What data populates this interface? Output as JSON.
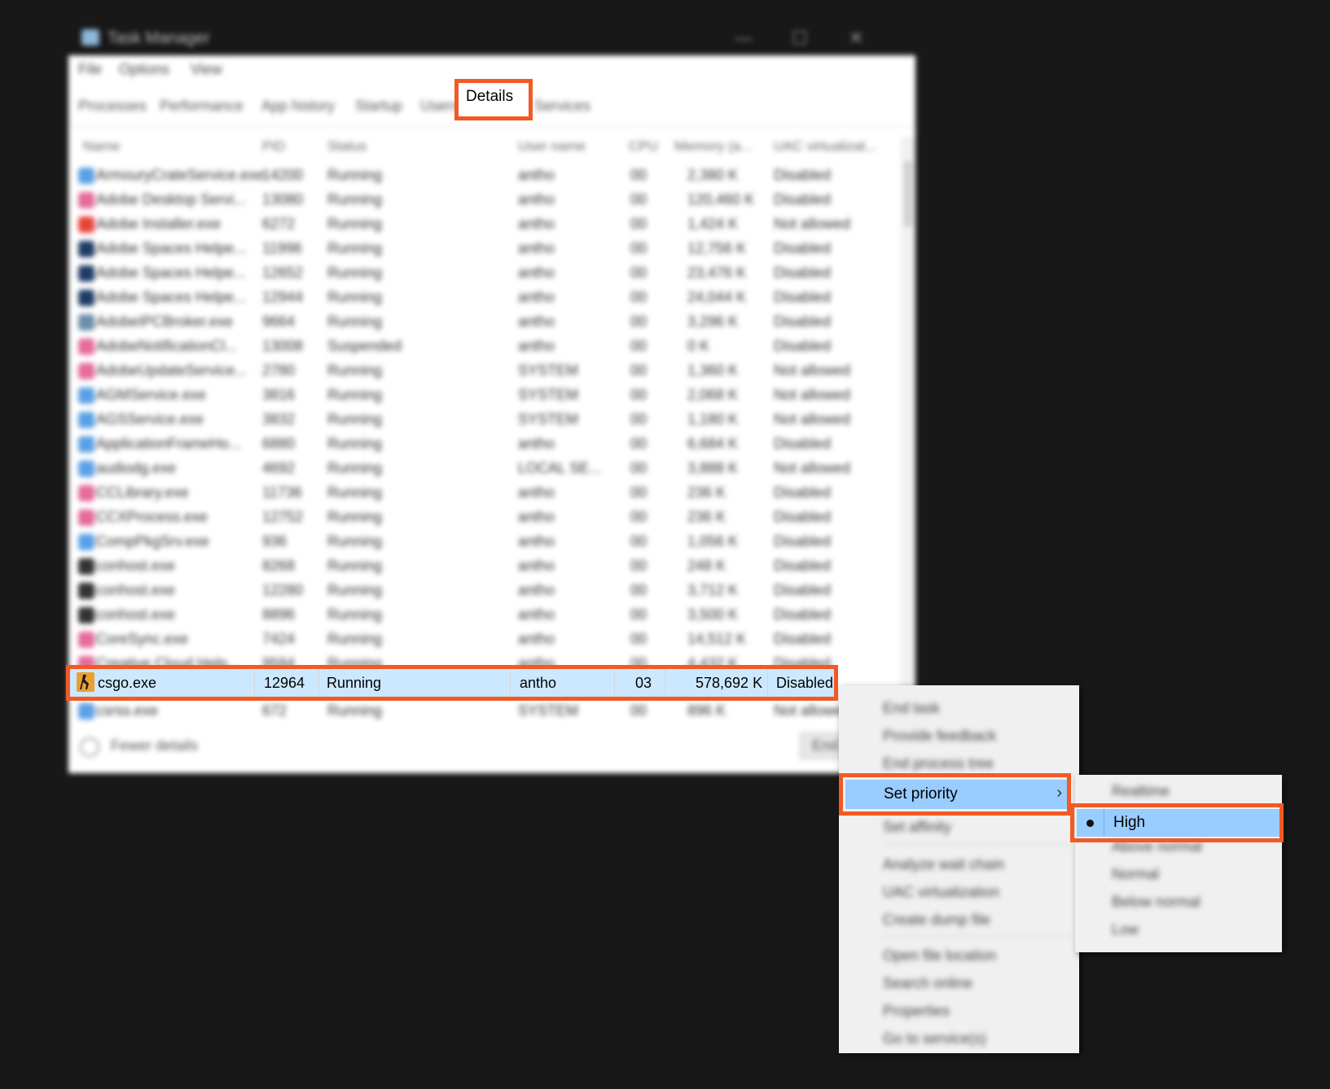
{
  "window": {
    "title": "Task Manager",
    "controls": [
      "—",
      "☐",
      "✕"
    ]
  },
  "menubar": [
    "File",
    "Options",
    "View"
  ],
  "tabs": {
    "processes": "Processes",
    "performance": "Performance",
    "app_history": "App history",
    "startup": "Startup",
    "users": "Users",
    "details": "Details",
    "services": "Services"
  },
  "columns": [
    "Name",
    "PID",
    "Status",
    "User name",
    "CPU",
    "Memory (a...",
    "UAC virtualizat..."
  ],
  "rows": [
    {
      "name": "ArmouryCrateService.exe",
      "pid": "14200",
      "status": "Running",
      "user": "antho",
      "cpu": "00",
      "mem": "2,380 K",
      "uac": "Disabled",
      "icon_color": "#5aa0e6"
    },
    {
      "name": "Adobe Desktop Servi...",
      "pid": "13080",
      "status": "Running",
      "user": "antho",
      "cpu": "00",
      "mem": "120,460 K",
      "uac": "Disabled",
      "icon_color": "#e56b9a"
    },
    {
      "name": "Adobe Installer.exe",
      "pid": "6272",
      "status": "Running",
      "user": "antho",
      "cpu": "00",
      "mem": "1,424 K",
      "uac": "Not allowed",
      "icon_color": "#e8443a"
    },
    {
      "name": "Adobe Spaces Helpe...",
      "pid": "11996",
      "status": "Running",
      "user": "antho",
      "cpu": "00",
      "mem": "12,756 K",
      "uac": "Disabled",
      "icon_color": "#1f3c66"
    },
    {
      "name": "Adobe Spaces Helpe...",
      "pid": "12652",
      "status": "Running",
      "user": "antho",
      "cpu": "00",
      "mem": "23,476 K",
      "uac": "Disabled",
      "icon_color": "#1f3c66"
    },
    {
      "name": "Adobe Spaces Helpe...",
      "pid": "12944",
      "status": "Running",
      "user": "antho",
      "cpu": "00",
      "mem": "24,044 K",
      "uac": "Disabled",
      "icon_color": "#1f3c66"
    },
    {
      "name": "AdobeIPCBroker.exe",
      "pid": "9664",
      "status": "Running",
      "user": "antho",
      "cpu": "00",
      "mem": "3,296 K",
      "uac": "Disabled",
      "icon_color": "#6a8fa8"
    },
    {
      "name": "AdobeNotificationCl...",
      "pid": "13008",
      "status": "Suspended",
      "user": "antho",
      "cpu": "00",
      "mem": "0 K",
      "uac": "Disabled",
      "icon_color": "#e56b9a"
    },
    {
      "name": "AdobeUpdateService...",
      "pid": "2780",
      "status": "Running",
      "user": "SYSTEM",
      "cpu": "00",
      "mem": "1,360 K",
      "uac": "Not allowed",
      "icon_color": "#e56b9a"
    },
    {
      "name": "AGMService.exe",
      "pid": "3816",
      "status": "Running",
      "user": "SYSTEM",
      "cpu": "00",
      "mem": "2,068 K",
      "uac": "Not allowed",
      "icon_color": "#5aa0e6"
    },
    {
      "name": "AGSService.exe",
      "pid": "3832",
      "status": "Running",
      "user": "SYSTEM",
      "cpu": "00",
      "mem": "1,180 K",
      "uac": "Not allowed",
      "icon_color": "#5aa0e6"
    },
    {
      "name": "ApplicationFrameHo...",
      "pid": "6880",
      "status": "Running",
      "user": "antho",
      "cpu": "00",
      "mem": "6,684 K",
      "uac": "Disabled",
      "icon_color": "#5aa0e6"
    },
    {
      "name": "audiodg.exe",
      "pid": "4692",
      "status": "Running",
      "user": "LOCAL SE...",
      "cpu": "00",
      "mem": "3,888 K",
      "uac": "Not allowed",
      "icon_color": "#5aa0e6"
    },
    {
      "name": "CCLibrary.exe",
      "pid": "11736",
      "status": "Running",
      "user": "antho",
      "cpu": "00",
      "mem": "236 K",
      "uac": "Disabled",
      "icon_color": "#e56b9a"
    },
    {
      "name": "CCXProcess.exe",
      "pid": "12752",
      "status": "Running",
      "user": "antho",
      "cpu": "00",
      "mem": "236 K",
      "uac": "Disabled",
      "icon_color": "#e56b9a"
    },
    {
      "name": "CompPkgSrv.exe",
      "pid": "936",
      "status": "Running",
      "user": "antho",
      "cpu": "00",
      "mem": "1,056 K",
      "uac": "Disabled",
      "icon_color": "#5aa0e6"
    },
    {
      "name": "conhost.exe",
      "pid": "8268",
      "status": "Running",
      "user": "antho",
      "cpu": "00",
      "mem": "248 K",
      "uac": "Disabled",
      "icon_color": "#333333"
    },
    {
      "name": "conhost.exe",
      "pid": "12280",
      "status": "Running",
      "user": "antho",
      "cpu": "00",
      "mem": "3,712 K",
      "uac": "Disabled",
      "icon_color": "#333333"
    },
    {
      "name": "conhost.exe",
      "pid": "8896",
      "status": "Running",
      "user": "antho",
      "cpu": "00",
      "mem": "3,500 K",
      "uac": "Disabled",
      "icon_color": "#333333"
    },
    {
      "name": "CoreSync.exe",
      "pid": "7424",
      "status": "Running",
      "user": "antho",
      "cpu": "00",
      "mem": "14,512 K",
      "uac": "Disabled",
      "icon_color": "#e56b9a"
    },
    {
      "name": "Creative Cloud Help...",
      "pid": "9584",
      "status": "Running",
      "user": "antho",
      "cpu": "00",
      "mem": "4,432 K",
      "uac": "Disabled",
      "icon_color": "#e56b9a"
    }
  ],
  "after_row": {
    "name": "csrss.exe",
    "pid": "672",
    "status": "Running",
    "user": "SYSTEM",
    "cpu": "00",
    "mem": "896 K",
    "uac": "Not allowed",
    "icon_color": "#5aa0e6"
  },
  "selected_row": {
    "name": "csgo.exe",
    "pid": "12964",
    "status": "Running",
    "user": "antho",
    "cpu": "03",
    "memory": "578,692 K",
    "uac": "Disabled"
  },
  "footer": {
    "fewer_details": "Fewer details",
    "end_task": "End task"
  },
  "context_menu": {
    "items": [
      "End task",
      "Provide feedback",
      "End process tree"
    ],
    "set_priority": "Set priority",
    "set_affinity": "Set affinity",
    "items2": [
      "Analyze wait chain",
      "UAC virtualization",
      "Create dump file"
    ],
    "items3": [
      "Open file location",
      "Search online",
      "Properties",
      "Go to service(s)"
    ]
  },
  "priority_menu": {
    "realtime": "Realtime",
    "high": "High",
    "others": [
      "Above normal",
      "Normal",
      "Below normal",
      "Low"
    ]
  },
  "colors": {
    "highlight_box": "#f15a24",
    "selection": "#cce8ff",
    "menu_hover": "#99ccff"
  }
}
